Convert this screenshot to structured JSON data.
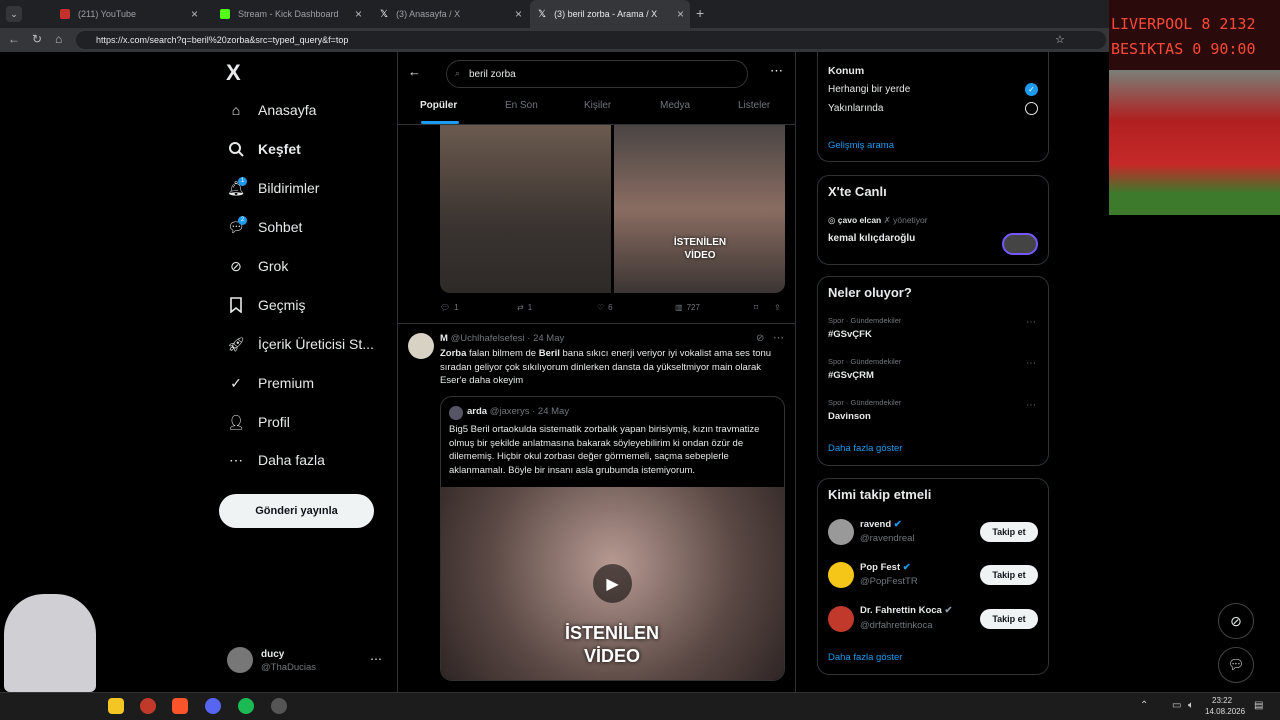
{
  "browser": {
    "tabs": [
      {
        "label": "(211) YouTube",
        "color": "#c4302b"
      },
      {
        "label": "Stream - Kick Dashboard",
        "color": "#53fc18"
      },
      {
        "label": "(3) Anasayfa / X",
        "color": "#ffffff"
      },
      {
        "label": "(3) beril zorba - Arama / X",
        "color": "#ffffff"
      }
    ],
    "url": "https://x.com/search?q=beril%20zorba&src=typed_query&f=top"
  },
  "sidebar": {
    "logo": "X",
    "items": [
      {
        "label": "Anasayfa"
      },
      {
        "label": "Keşfet"
      },
      {
        "label": "Bildirimler",
        "badge": "1"
      },
      {
        "label": "Sohbet",
        "badge": "2"
      },
      {
        "label": "Grok"
      },
      {
        "label": "Geçmiş"
      },
      {
        "label": "İçerik Üreticisi St..."
      },
      {
        "label": "Premium"
      },
      {
        "label": "Profil"
      },
      {
        "label": "Daha fazla"
      }
    ],
    "post_button": "Gönderi yayınla",
    "account": {
      "name": "ducy",
      "handle": "@ThaDucias"
    }
  },
  "search": {
    "query": "beril zorba",
    "tabs": [
      "Popüler",
      "En Son",
      "Kişiler",
      "Medya",
      "Listeler"
    ]
  },
  "tweet1": {
    "overlay_text": "İSTENİLEN VİDEO",
    "replies": "1",
    "retweets": "1",
    "likes": "6",
    "views": "727"
  },
  "tweet2": {
    "name": "M",
    "handle": "@Uchlhafelsefesi",
    "date": "24 May",
    "bold1": "Zorba",
    "mid1": " falan bilmem de ",
    "bold2": "Beril",
    "text": " bana sıkıcı enerji veriyor iyi vokalist ama ses tonu sıradan geliyor çok sıkılıyorum dinlerken dansta da yükseltmiyor main olarak Eser'e daha okeyim",
    "quote": {
      "name": "arda",
      "handle": "@jaxerys",
      "date": "24 May",
      "text": "Big5 Beril ortaokulda sistematik zorbalık yapan birisiymiş, kızın travmatize olmuş bir şekilde anlatmasına bakarak söyleyebilirim ki ondan özür de dilememiş. Hiçbir okul zorbası değer görmemeli, saçma sebeplerle aklanmamalı. Böyle bir insanı asla grubumda istemiyorum.",
      "overlay_text": "İSTENİLEN VİDEO"
    }
  },
  "filters": {
    "location_title": "Konum",
    "opt1": "Herhangi bir yerde",
    "opt2": "Yakınlarında",
    "advanced": "Gelişmiş arama"
  },
  "live": {
    "title": "X'te Canlı",
    "host": "çavo elcan",
    "host_suffix": "yönetiyor",
    "topic": "kemal kılıçdaroğlu"
  },
  "trends": {
    "title": "Neler oluyor?",
    "items": [
      {
        "category": "Spor · Gündemdekiler",
        "name": "#GSvÇFK"
      },
      {
        "category": "Spor · Gündemdekiler",
        "name": "#GSvÇRM"
      },
      {
        "category": "Spor · Gündemdekiler",
        "name": "Davinson"
      }
    ],
    "more": "Daha fazla göster"
  },
  "who_to_follow": {
    "title": "Kimi takip etmeli",
    "users": [
      {
        "name": "ravend",
        "handle": "@ravendreal",
        "button": "Takip et"
      },
      {
        "name": "Pop Fest",
        "handle": "@PopFestTR",
        "button": "Takip et"
      },
      {
        "name": "Dr. Fahrettin Koca",
        "handle": "@drfahrettinkoca",
        "button": "Takip et"
      }
    ],
    "more": "Daha fazla göster"
  },
  "scoreboard": {
    "team1": "LIVERPOOL",
    "score1": "8",
    "team2": "BESIKTAS",
    "score2": "0",
    "time1": "2132",
    "time2": "90:00"
  },
  "taskbar": {
    "time": "23:22",
    "date": "14.08.2026"
  },
  "colors": {
    "accent": "#1d9bf0",
    "bg": "#000000"
  }
}
